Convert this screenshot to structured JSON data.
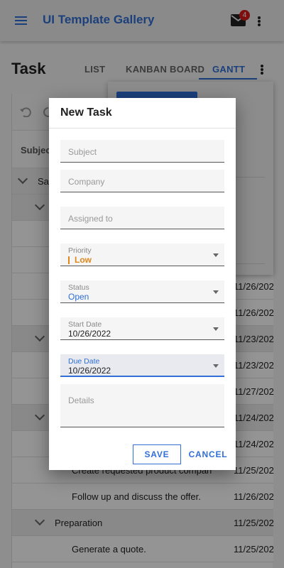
{
  "app": {
    "title": "UI Template Gallery",
    "notification_count": "4"
  },
  "page": {
    "title": "Task",
    "tabs": [
      {
        "label": "LIST",
        "active": false
      },
      {
        "label": "KANBAN BOARD",
        "active": false
      },
      {
        "label": "GANTT",
        "active": true
      }
    ]
  },
  "grid": {
    "header": "Subject",
    "rows": [
      {
        "type": "group",
        "text": "Sal",
        "date": ""
      },
      {
        "type": "group",
        "text": "",
        "date": ""
      },
      {
        "type": "task",
        "text": "",
        "date": ""
      },
      {
        "type": "task",
        "text": "",
        "date": ""
      },
      {
        "type": "task",
        "text": "",
        "date": "11/26/202"
      },
      {
        "type": "task",
        "text": "",
        "date": "11/26/202"
      },
      {
        "type": "group",
        "text": "",
        "date": "11/23/202"
      },
      {
        "type": "task",
        "text": "",
        "date": "11/23/202"
      },
      {
        "type": "task",
        "text": "",
        "date": "11/27/202"
      },
      {
        "type": "group",
        "text": "",
        "date": "11/24/202"
      },
      {
        "type": "task",
        "text": "",
        "date": "11/24/202"
      },
      {
        "type": "task",
        "text": "Create requested product compari",
        "date": "11/25/202"
      },
      {
        "type": "task",
        "text": "Follow up and discuss the offer.",
        "date": "11/26/202"
      },
      {
        "type": "group",
        "text": "Preparation",
        "date": "11/25/202"
      },
      {
        "type": "task",
        "text": "Generate a quote.",
        "date": "11/25/202"
      }
    ]
  },
  "dialog": {
    "title": "New Task",
    "subject": {
      "placeholder": "Subject"
    },
    "company": {
      "placeholder": "Company"
    },
    "assigned": {
      "placeholder": "Assigned to"
    },
    "priority": {
      "label": "Priority",
      "value": "Low",
      "color": "#e0871a"
    },
    "status": {
      "label": "Status",
      "value": "Open"
    },
    "start_date": {
      "label": "Start Date",
      "value": "10/26/2022"
    },
    "due_date": {
      "label": "Due Date",
      "value": "10/26/2022"
    },
    "details": {
      "placeholder": "Details"
    },
    "save_label": "SAVE",
    "cancel_label": "CANCEL"
  },
  "colors": {
    "accent": "#2f6fd6",
    "badge": "#d81b1b",
    "priority_low": "#e0871a"
  }
}
